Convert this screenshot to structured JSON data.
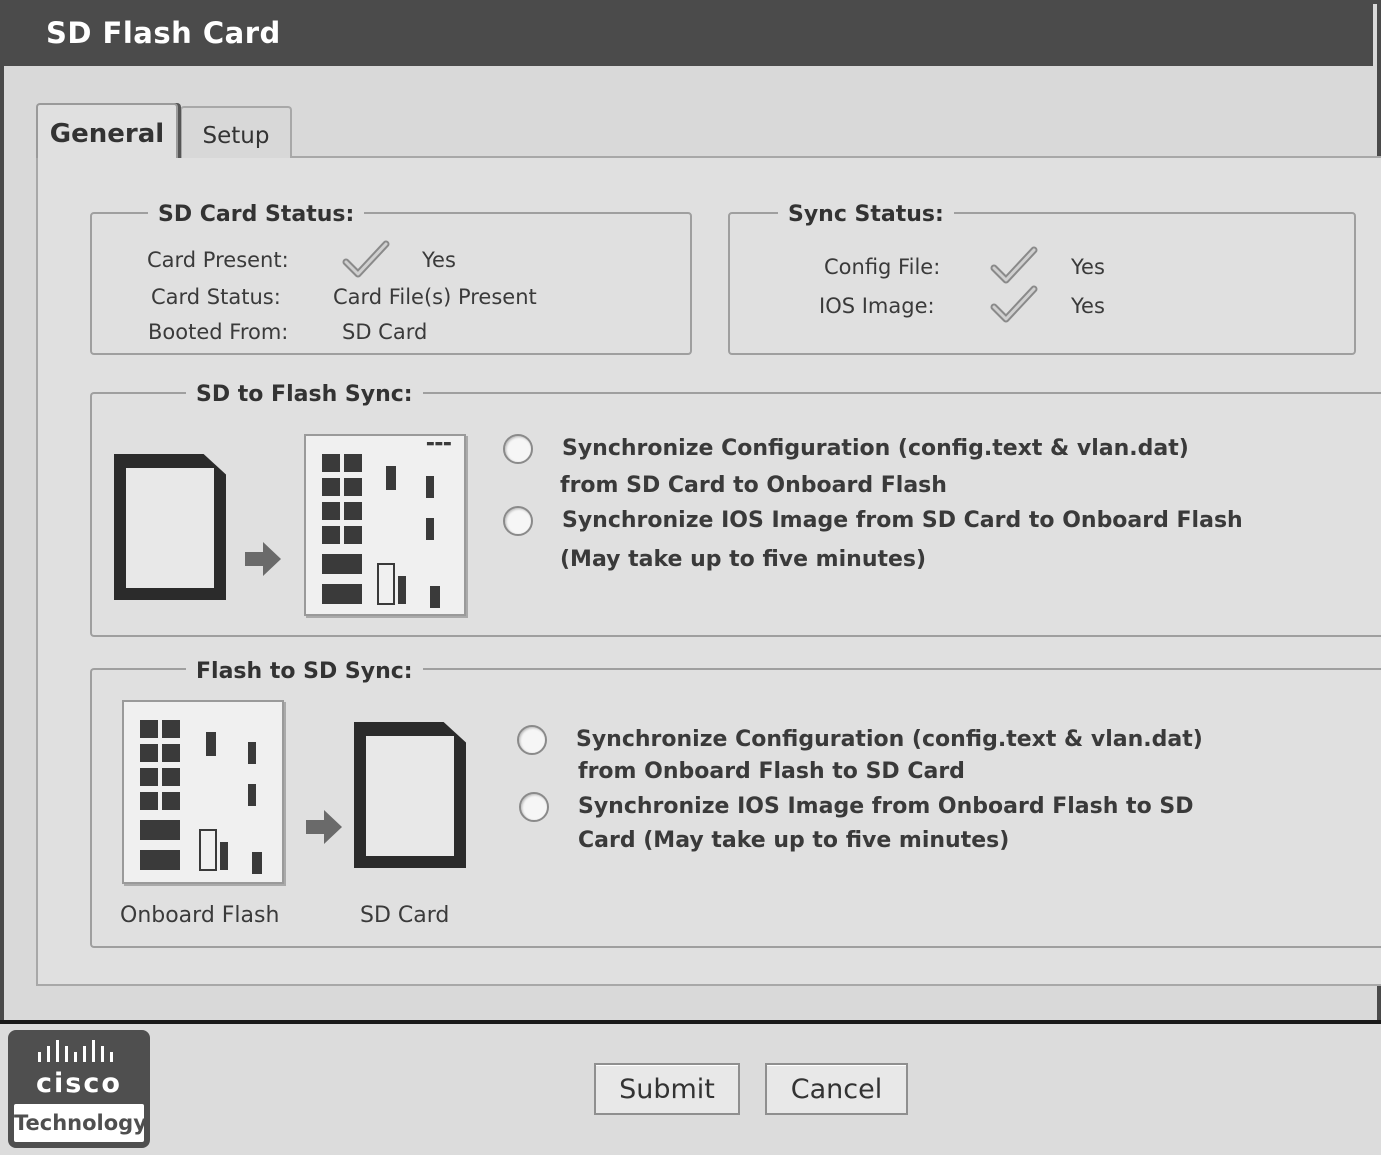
{
  "window": {
    "title": "SD Flash Card"
  },
  "tabs": [
    {
      "label": "General"
    },
    {
      "label": "Setup"
    }
  ],
  "sd_card_status": {
    "legend": "SD Card Status:",
    "card_present_label": "Card Present:",
    "card_present_value": "Yes",
    "card_status_label": "Card Status:",
    "card_status_value": "Card File(s) Present",
    "booted_from_label": "Booted From:",
    "booted_from_value": "SD Card"
  },
  "sync_status": {
    "legend": "Sync Status:",
    "config_file_label": "Config File:",
    "config_file_value": "Yes",
    "ios_image_label": "IOS Image:",
    "ios_image_value": "Yes"
  },
  "sd_to_flash": {
    "legend": "SD to Flash Sync:",
    "option1_line1": "Synchronize Configuration (config.text & vlan.dat)",
    "option1_line2": "from SD Card to Onboard Flash",
    "option2_line1": "Synchronize IOS Image from SD Card to Onboard Flash",
    "option2_line2": "(May take up to five minutes)"
  },
  "flash_to_sd": {
    "legend": "Flash to SD Sync:",
    "option1_line1": "Synchronize Configuration (config.text & vlan.dat)",
    "option1_line2": "from Onboard Flash to SD Card",
    "option2_line1": "Synchronize IOS Image from Onboard Flash to SD",
    "option2_line2": "Card (May take up to five minutes)",
    "caption_flash": "Onboard Flash",
    "caption_sd": "SD Card"
  },
  "buttons": {
    "submit": "Submit",
    "cancel": "Cancel"
  },
  "logo": {
    "wordmark": "cisco",
    "subtitle": "Technology"
  }
}
